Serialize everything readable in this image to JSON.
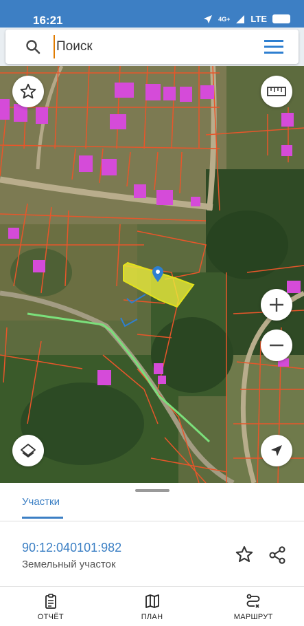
{
  "status_bar": {
    "time": "16:21",
    "network": "4G+",
    "lte": "LTE",
    "battery": ""
  },
  "search": {
    "placeholder": "Поиск",
    "value": ""
  },
  "map": {
    "selected_color": "#f0f03c",
    "boundary_color": "#e8562a",
    "road_color": "#7be07b",
    "building_color": "#d54bd9",
    "marker_color": "#2e7fd0"
  },
  "sheet": {
    "tab_label": "Участки",
    "parcel_number": "90:12:040101:982",
    "parcel_type": "Земельный участок"
  },
  "nav": {
    "report": "ОТЧЁТ",
    "plan": "ПЛАН",
    "route": "МАРШРУТ"
  },
  "icons": [
    "search-icon",
    "menu-icon",
    "star-icon",
    "ruler-icon",
    "zoom-in-icon",
    "zoom-out-icon",
    "layers-icon",
    "locate-icon",
    "share-icon",
    "report-icon",
    "map-icon",
    "route-icon",
    "location-pin-icon"
  ]
}
